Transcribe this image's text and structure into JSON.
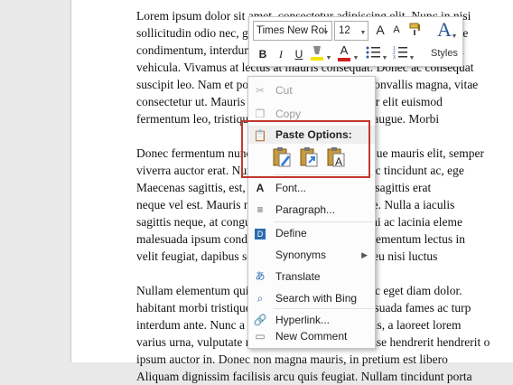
{
  "document": {
    "paragraphs": [
      [
        "Lorem ipsum dolor sit amet, consectetur adipiscing elit. Nunc in nisi",
        "sollicitudin odio nec, gravida tortor. Fusce vel tortor in egestas vitae",
        "condimentum, interdum condimentum orci. Aenean dictum erat vel",
        "vehicula. Vivamus at lectus at mauris consequat. Donec ac consequat",
        "suscipit leo. Nam et porta ipsum. Fusce dictum convallis magna, vitae",
        "consectetur ut. Mauris tristique tempus, in tempor elit euismod",
        "fermentum leo, tristique nec feugiat et, in luctus augue. Morbi"
      ],
      [
        "Donec fermentum nunc vel nisl accumsan. Quisque mauris elit, semper",
        "viverra auctor erat. Nunc ut libero consectetur nec tincidunt ac, ege",
        "Maecenas sagittis, est, in porta mollis, risus eros sagittis erat",
        "neque vel est. Mauris nec consectetur odio ornare. Nulla a iaculis",
        "sagittis neque, at congue. Nam ac odio lobortis mi ac lacinia eleme",
        "malesuada ipsum condimentum et. Ut pharetra elementum lectus in",
        "velit feugiat, dapibus sem quis orci. Ut eu purus eu nisi luctus"
      ],
      [
        "Nullam elementum quis sagittis, ut lacinia. Donec eget diam dolor.",
        "habitant morbi tristique senectus et netus et malesuada fames ac turp",
        "interdum ante. Nunc a tincidunt urna, lacus iaculis, a laoreet lorem",
        "varius urna, vulputate non vestibulum. Suspendisse hendrerit hendrerit o",
        "ipsum auctor in. Donec non magna mauris, in pretium est libero",
        "Aliquam dignissim facilisis arcu quis feugiat. Nullam tincidunt porta"
      ]
    ]
  },
  "mini_toolbar": {
    "font_name": "Times New Roi",
    "font_size": "12",
    "grow_font": "A",
    "shrink_font": "A",
    "bold": "B",
    "italic": "I",
    "underline": "U",
    "font_color_letter": "A",
    "styles_label": "Styles",
    "highlight_color": "#f5e400",
    "font_color": "#d11e1e"
  },
  "context_menu": {
    "items": [
      {
        "label": "Cut",
        "icon": "scissors-icon",
        "enabled": false
      },
      {
        "label": "Copy",
        "icon": "copy-icon",
        "enabled": false
      },
      {
        "label": "Paste Options:",
        "icon": "clipboard-icon",
        "enabled": true
      },
      {
        "label": "Font...",
        "icon": "font-icon",
        "enabled": true
      },
      {
        "label": "Paragraph...",
        "icon": "paragraph-icon",
        "enabled": true
      },
      {
        "label": "Define",
        "icon": "define-icon",
        "enabled": true
      },
      {
        "label": "Synonyms",
        "icon": "",
        "enabled": true
      },
      {
        "label": "Translate",
        "icon": "translate-icon",
        "enabled": true
      },
      {
        "label": "Search with Bing",
        "icon": "search-icon",
        "enabled": true
      },
      {
        "label": "Hyperlink...",
        "icon": "hyperlink-icon",
        "enabled": true
      },
      {
        "label": "New Comment",
        "icon": "comment-icon",
        "enabled": true
      }
    ],
    "paste_options": [
      "keep-source-formatting",
      "merge-formatting",
      "keep-text-only"
    ],
    "highlight_color": "#c0392b"
  }
}
